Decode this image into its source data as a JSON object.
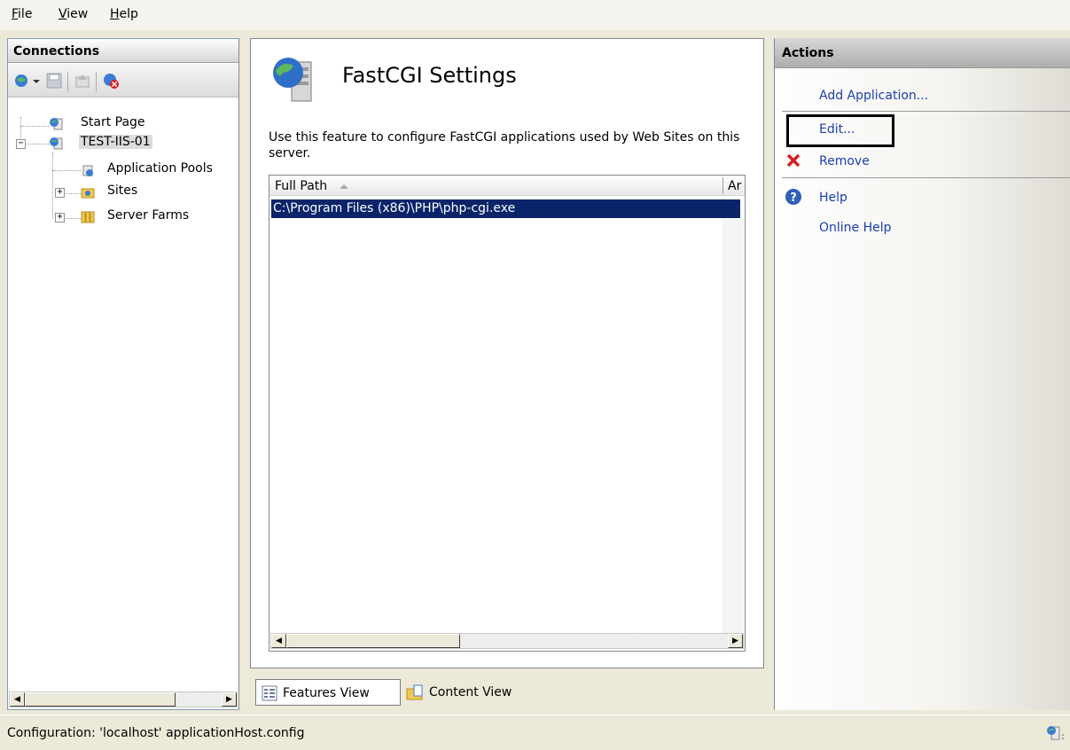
{
  "menu": {
    "items": [
      {
        "accel": "F",
        "rest": "ile"
      },
      {
        "accel": "V",
        "rest": "iew"
      },
      {
        "accel": "H",
        "rest": "elp"
      }
    ]
  },
  "connections": {
    "title": "Connections",
    "tree": {
      "start_page": "Start Page",
      "server": "TEST-IIS-01",
      "app_pools": "Application Pools",
      "sites": "Sites",
      "server_farms": "Server Farms"
    }
  },
  "center": {
    "title": "FastCGI Settings",
    "description": "Use this feature to configure FastCGI applications used by Web Sites on this server.",
    "columns": [
      "Full Path",
      "Ar"
    ],
    "rows": [
      "C:\\Program Files (x86)\\PHP\\php-cgi.exe"
    ],
    "tabs": {
      "features_view": "Features View",
      "content_view": "Content View"
    }
  },
  "actions": {
    "title": "Actions",
    "add_application": "Add Application...",
    "edit": "Edit...",
    "remove": "Remove",
    "help": "Help",
    "online_help": "Online Help"
  },
  "status": {
    "text": "Configuration: 'localhost' applicationHost.config"
  },
  "colors": {
    "selection": "#0a246a",
    "link": "#1c3faa",
    "remove_red": "#d42020"
  },
  "icons": [
    "globe-server-icon",
    "save-icon",
    "up-icon",
    "disconnect-icon",
    "app-pool-icon",
    "sites-icon",
    "server-farm-icon",
    "help-icon",
    "remove-icon",
    "sort-up-icon"
  ]
}
